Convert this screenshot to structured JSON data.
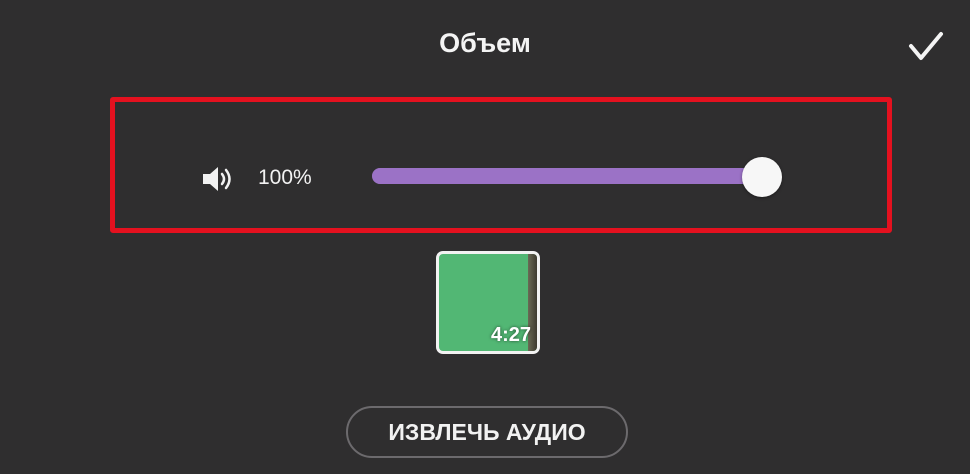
{
  "header": {
    "title": "Объем",
    "confirm_icon": "checkmark-icon"
  },
  "volume": {
    "icon": "speaker-icon",
    "value_label": "100%",
    "level": 1.0,
    "fill_color": "#9b72c6",
    "track_color": "#5a565d"
  },
  "highlight": {
    "color": "#e4111f"
  },
  "clip": {
    "duration": "4:27",
    "thumb_color": "#52b774"
  },
  "actions": {
    "extract_audio_label": "ИЗВЛЕЧЬ АУДИО"
  }
}
